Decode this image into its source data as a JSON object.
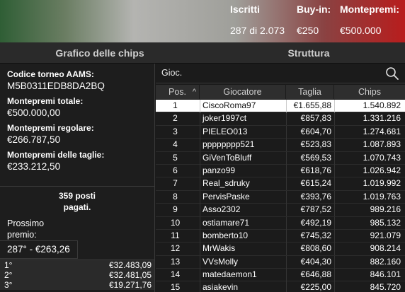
{
  "header": {
    "stats": [
      {
        "label": "Iscritti",
        "value": "287 di 2.073"
      },
      {
        "label": "Buy-in:",
        "value": "€250"
      },
      {
        "label": "Montepremi:",
        "value": "€500.000"
      }
    ]
  },
  "tabs": {
    "chart": "Grafico delle chips",
    "structure": "Struttura"
  },
  "info": {
    "code_label": "Codice torneo AAMS:",
    "code_value": "M5B0311EDB8DA2BQ",
    "total_label": "Montepremi totale:",
    "total_value": "€500.000,00",
    "regular_label": "Montepremi regolare:",
    "regular_value": "€266.787,50",
    "bounty_label": "Montepremi delle taglie:",
    "bounty_value": "€233.212,50"
  },
  "places_line1": "359 posti",
  "places_line2": "pagati.",
  "next_prize_line1": "Prossimo",
  "next_prize_line2": "premio:",
  "next_prize_value": "287° - €263,26",
  "payouts": [
    {
      "place": "1°",
      "amount": "€32.483,09"
    },
    {
      "place": "2°",
      "amount": "€32.481,05"
    },
    {
      "place": "3°",
      "amount": "€19.271,76"
    }
  ],
  "search": {
    "placeholder": "Gioc.",
    "icon": "search-icon"
  },
  "table": {
    "headers": {
      "pos": "Pos.",
      "sort_icon": "^",
      "player": "Giocatore",
      "stack": "Taglia",
      "chips": "Chips"
    },
    "rows": [
      {
        "pos": "1",
        "name": "CiscoRoma97",
        "stack": "€1.655,88",
        "chips": "1.540.892"
      },
      {
        "pos": "2",
        "name": "joker1997ct",
        "stack": "€857,83",
        "chips": "1.331.216"
      },
      {
        "pos": "3",
        "name": "PIELEO013",
        "stack": "€604,70",
        "chips": "1.274.681"
      },
      {
        "pos": "4",
        "name": "pppppppp521",
        "stack": "€523,83",
        "chips": "1.087.893"
      },
      {
        "pos": "5",
        "name": "GiVenToBluff",
        "stack": "€569,53",
        "chips": "1.070.743"
      },
      {
        "pos": "6",
        "name": "panzo99",
        "stack": "€618,76",
        "chips": "1.026.942"
      },
      {
        "pos": "7",
        "name": "Real_sdruky",
        "stack": "€615,24",
        "chips": "1.019.992"
      },
      {
        "pos": "8",
        "name": "PervisPaske",
        "stack": "€393,76",
        "chips": "1.019.763"
      },
      {
        "pos": "9",
        "name": "Asso2302",
        "stack": "€787,52",
        "chips": "989.216"
      },
      {
        "pos": "10",
        "name": "ostiamare71",
        "stack": "€492,19",
        "chips": "985.132"
      },
      {
        "pos": "11",
        "name": "bomberto10",
        "stack": "€745,32",
        "chips": "921.079"
      },
      {
        "pos": "12",
        "name": "MrWakis",
        "stack": "€808,60",
        "chips": "908.214"
      },
      {
        "pos": "13",
        "name": "VVsMolly",
        "stack": "€404,30",
        "chips": "882.160"
      },
      {
        "pos": "14",
        "name": "matedaemon1",
        "stack": "€646,88",
        "chips": "846.101"
      },
      {
        "pos": "15",
        "name": "asiakevin",
        "stack": "€225,00",
        "chips": "845.720"
      }
    ],
    "selected_index": 0
  },
  "colors": {
    "selected_row": "#ffffff",
    "background": "#1b1b1b"
  }
}
